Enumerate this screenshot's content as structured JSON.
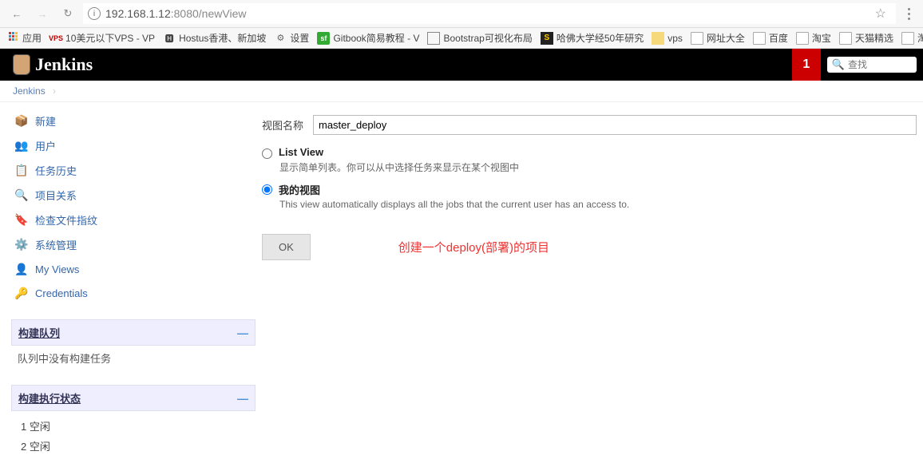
{
  "browser": {
    "url_host": "192.168.1.12",
    "url_port": ":8080",
    "url_path": "/newView"
  },
  "bookmarks": {
    "apps": "应用",
    "items": [
      "10美元以下VPS - VP",
      "Hostus香港、新加坡",
      "设置",
      "Gitbook简易教程 - V",
      "Bootstrap可视化布局",
      "哈佛大学经50年研究",
      "vps",
      "网址大全",
      "百度",
      "淘宝",
      "天猫精选",
      "淘"
    ]
  },
  "header": {
    "title": "Jenkins",
    "notif_count": "1",
    "search_placeholder": "查找"
  },
  "breadcrumb": {
    "root": "Jenkins"
  },
  "sidebar": {
    "links": [
      {
        "label": "新建"
      },
      {
        "label": "用户"
      },
      {
        "label": "任务历史"
      },
      {
        "label": "项目关系"
      },
      {
        "label": "检查文件指纹"
      },
      {
        "label": "系统管理"
      },
      {
        "label": "My Views"
      },
      {
        "label": "Credentials"
      }
    ],
    "queue_title": "构建队列",
    "queue_empty": "队列中没有构建任务",
    "exec_title": "构建执行状态",
    "exec_rows": [
      "1 空闲",
      "2 空闲"
    ]
  },
  "form": {
    "name_label": "视图名称",
    "name_value": "master_deploy",
    "listview_label": "List View",
    "listview_desc": "显示简单列表。你可以从中选择任务来显示在某个视图中",
    "myview_label": "我的视图",
    "myview_desc": "This view automatically displays all the jobs that the current user has an access to.",
    "ok_label": "OK",
    "annotation": "创建一个deploy(部署)的项目"
  }
}
